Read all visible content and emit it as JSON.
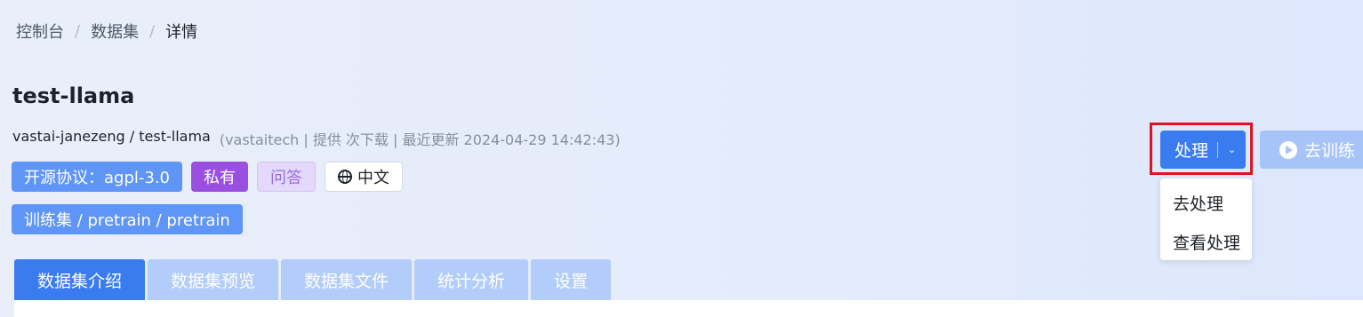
{
  "breadcrumb": {
    "items": [
      "控制台",
      "数据集",
      "详情"
    ],
    "separator": "/"
  },
  "dataset": {
    "title": "test-llama",
    "owner_path": "vastai-janezeng / test-llama",
    "meta_extra": "(vastaitech | 提供 次下载 | 最近更新 2024-04-29 14:42:43)"
  },
  "tags": {
    "license": "开源协议：agpl-3.0",
    "visibility": "私有",
    "task": "问答",
    "language": "中文",
    "trainset": "训练集 / pretrain / pretrain"
  },
  "tabs": [
    {
      "label": "数据集介绍",
      "active": true
    },
    {
      "label": "数据集预览",
      "active": false
    },
    {
      "label": "数据集文件",
      "active": false
    },
    {
      "label": "统计分析",
      "active": false
    },
    {
      "label": "设置",
      "active": false
    }
  ],
  "actions": {
    "process_label": "处理",
    "train_label": "去训练",
    "menu": [
      "去处理",
      "查看处理"
    ]
  },
  "icons": {
    "language": "globe-icon",
    "process_toggle": "chevron-down-icon",
    "train": "play-circle-icon"
  },
  "colors": {
    "primary": "#3a7cf0",
    "highlight_border": "#e0141e",
    "private_tag": "#9a4fe0"
  }
}
